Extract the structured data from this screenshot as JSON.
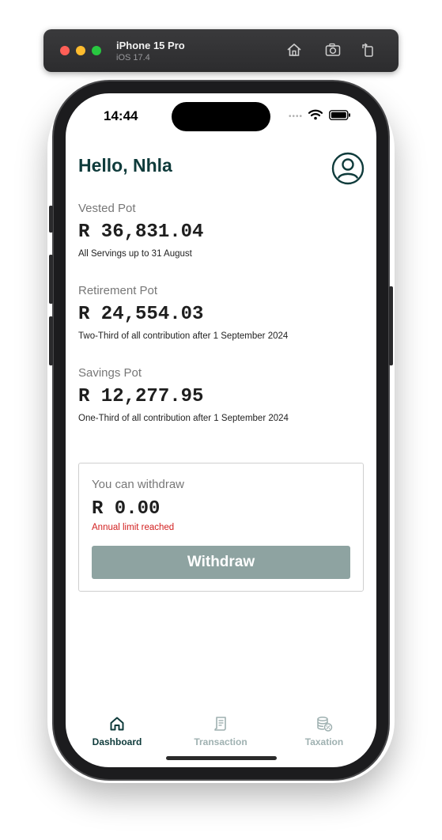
{
  "simulator": {
    "device": "iPhone 15 Pro",
    "os": "iOS 17.4"
  },
  "status_bar": {
    "time": "14:44"
  },
  "header": {
    "greeting": "Hello, Nhla"
  },
  "pots": [
    {
      "label": "Vested Pot",
      "amount": "R 36,831.04",
      "description": "All Servings up to 31 August"
    },
    {
      "label": "Retirement Pot",
      "amount": "R 24,554.03",
      "description": "Two-Third of all contribution after 1 September 2024"
    },
    {
      "label": "Savings Pot",
      "amount": "R 12,277.95",
      "description": "One-Third of all contribution after 1 September 2024"
    }
  ],
  "withdraw": {
    "label": "You can withdraw",
    "amount": "R 0.00",
    "limit_message": "Annual limit reached",
    "button_label": "Withdraw"
  },
  "tabs": [
    {
      "label": "Dashboard",
      "icon": "home-icon",
      "active": true
    },
    {
      "label": "Transaction",
      "icon": "receipt-icon",
      "active": false
    },
    {
      "label": "Taxation",
      "icon": "coins-percent-icon",
      "active": false
    }
  ],
  "colors": {
    "primary": "#0f3b3b",
    "button_disabled": "#8ea3a1",
    "error": "#d21f1f",
    "tab_inactive": "#9fb1b1"
  }
}
